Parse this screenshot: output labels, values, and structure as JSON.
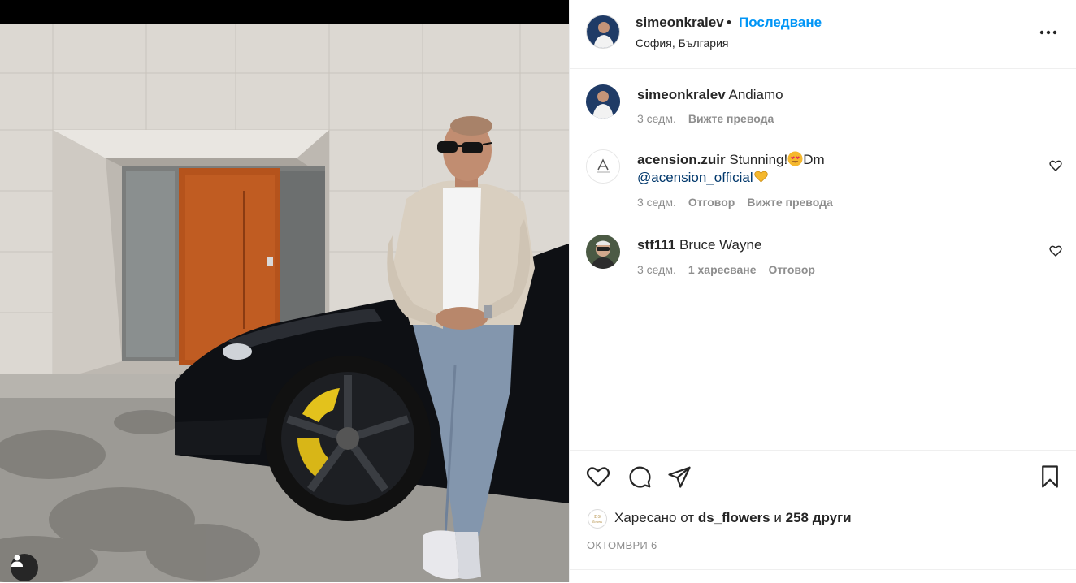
{
  "post": {
    "author": "simeonkralev",
    "separator": "•",
    "follow_label": "Последване",
    "location": "София, България"
  },
  "comments": [
    {
      "username": "simeonkralev",
      "text": "Andiamo",
      "time": "3 седм.",
      "actions": [
        "Вижте превода"
      ]
    },
    {
      "username": "acension.zuir",
      "text": "Stunning!",
      "text2": "Dm",
      "mention": "@acension_official",
      "time": "3 седм.",
      "actions": [
        "Отговор",
        "Вижте превода"
      ]
    },
    {
      "username": "stf111",
      "text": "Bruce Wayne",
      "time": "3 седм.",
      "actions": [
        "1 харесване",
        "Отговор"
      ]
    }
  ],
  "likes": {
    "prefix": "Харесано от",
    "user": "ds_flowers",
    "conjunction": "и",
    "others": "258 други"
  },
  "date": "ОКТОМВРИ 6",
  "icons": {
    "more": "more-horizontal-icon",
    "like": "heart-icon",
    "comment": "comment-bubble-icon",
    "share": "paper-plane-icon",
    "save": "bookmark-icon",
    "user_tag": "user-tag-icon"
  }
}
